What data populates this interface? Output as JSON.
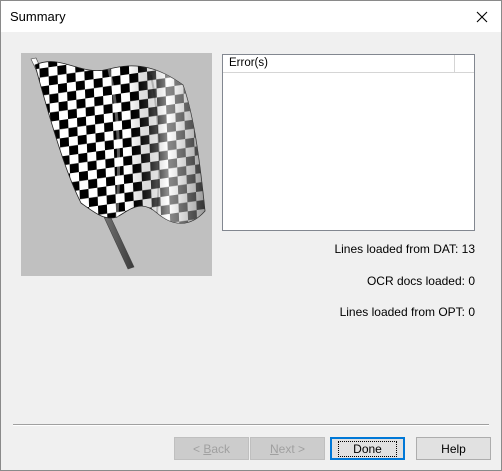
{
  "window": {
    "title": "Summary"
  },
  "icons": {
    "close": "close-icon",
    "flag": "checkered-flag-icon"
  },
  "errors_list": {
    "column_header": "Error(s)",
    "rows": []
  },
  "stats": {
    "dat_lines": "Lines loaded from DAT: 13",
    "ocr_docs": "OCR docs loaded: 0",
    "opt_lines": "Lines loaded from OPT: 0"
  },
  "buttons": {
    "back_prefix": "< ",
    "back_key": "B",
    "back_rest": "ack",
    "next_key": "N",
    "next_rest": "ext >",
    "done": "Done",
    "help": "Help"
  },
  "colors": {
    "focus_border": "#0078d7",
    "disabled_text": "#a0a0a0"
  }
}
